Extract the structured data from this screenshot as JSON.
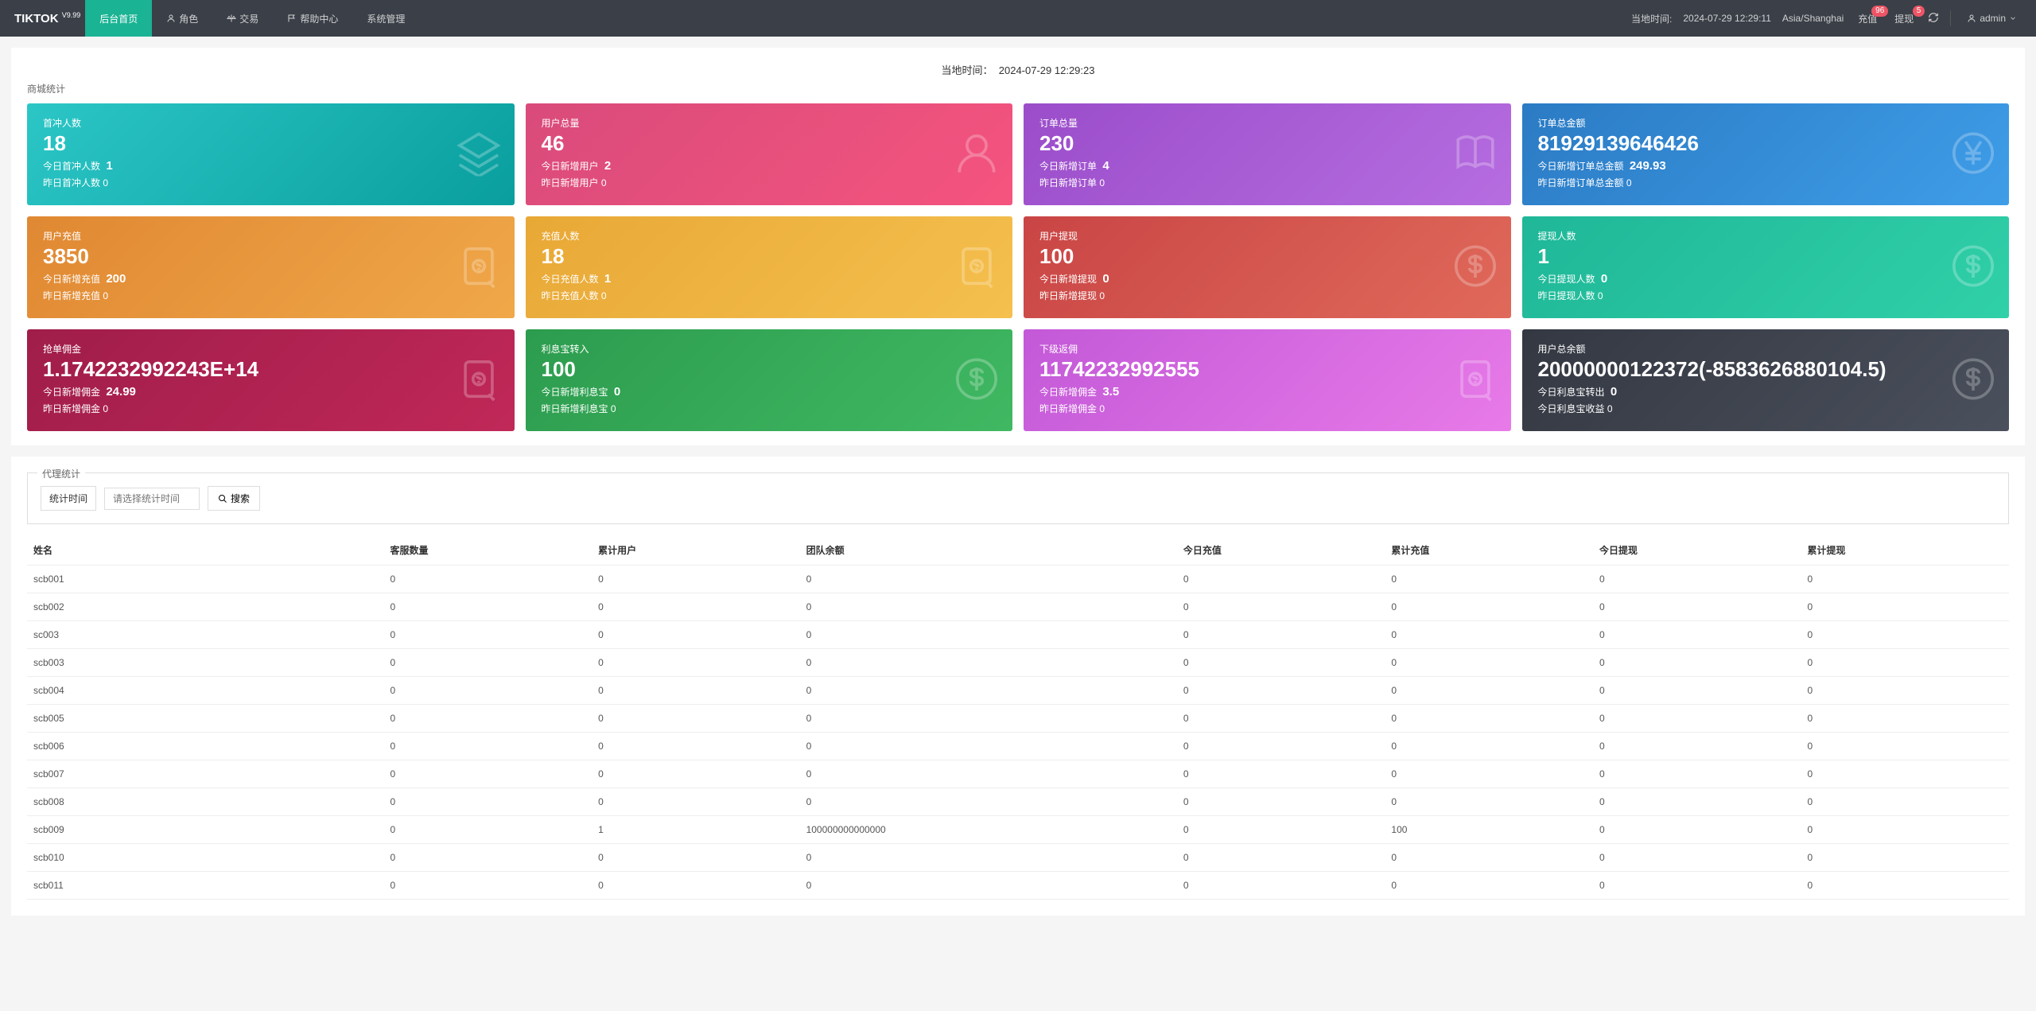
{
  "brand": {
    "name": "TIKTOK",
    "ver": "V9.99"
  },
  "nav": {
    "home": "后台首页",
    "role": "角色",
    "trade": "交易",
    "help": "帮助中心",
    "sys": "系统管理"
  },
  "navr": {
    "time_label": "当地时间:",
    "time_value": "2024-07-29 12:29:11",
    "tz": "Asia/Shanghai",
    "recharge": "充值",
    "recharge_badge": "96",
    "withdraw": "提现",
    "withdraw_badge": "5",
    "user": "admin"
  },
  "local_time": {
    "label": "当地时间：",
    "value": "2024-07-29 12:29:23"
  },
  "mall_title": "商城统计",
  "stats": [
    {
      "grad": "g-cyan",
      "t1": "首冲人数",
      "big": "18",
      "l2a": "今日首冲人数",
      "l2b": "1",
      "l3a": "昨日首冲人数",
      "l3b": "0",
      "icon": "layers"
    },
    {
      "grad": "g-pink",
      "t1": "用户总量",
      "big": "46",
      "l2a": "今日新增用户",
      "l2b": "2",
      "l3a": "昨日新增用户",
      "l3b": "0",
      "icon": "user"
    },
    {
      "grad": "g-purple",
      "t1": "订单总量",
      "big": "230",
      "l2a": "今日新增订单",
      "l2b": "4",
      "l3a": "昨日新增订单",
      "l3b": "0",
      "icon": "book"
    },
    {
      "grad": "g-blue",
      "t1": "订单总金额",
      "big": "81929139646426",
      "l2a": "今日新增订单总金额",
      "l2b": "249.93",
      "l3a": "昨日新增订单总金额",
      "l3b": "0",
      "icon": "yen"
    },
    {
      "grad": "g-orange",
      "t1": "用户充值",
      "big": "3850",
      "l2a": "今日新增充值",
      "l2b": "200",
      "l3a": "昨日新增充值",
      "l3b": "0",
      "icon": "note"
    },
    {
      "grad": "g-yellow",
      "t1": "充值人数",
      "big": "18",
      "l2a": "今日充值人数",
      "l2b": "1",
      "l3a": "昨日充值人数",
      "l3b": "0",
      "icon": "note"
    },
    {
      "grad": "g-red",
      "t1": "用户提现",
      "big": "100",
      "l2a": "今日新增提现",
      "l2b": "0",
      "l3a": "昨日新增提现",
      "l3b": "0",
      "icon": "dollar"
    },
    {
      "grad": "g-mint",
      "t1": "提现人数",
      "big": "1",
      "l2a": "今日提现人数",
      "l2b": "0",
      "l3a": "昨日提现人数",
      "l3b": "0",
      "icon": "dollar"
    },
    {
      "grad": "g-wine",
      "t1": "抢单佣金",
      "big": "1.1742232992243E+14",
      "l2a": "今日新增佣金",
      "l2b": "24.99",
      "l3a": "昨日新增佣金",
      "l3b": "0",
      "icon": "note"
    },
    {
      "grad": "g-green",
      "t1": "利息宝转入",
      "big": "100",
      "l2a": "今日新增利息宝",
      "l2b": "0",
      "l3a": "昨日新增利息宝",
      "l3b": "0",
      "icon": "dollar"
    },
    {
      "grad": "g-violet",
      "t1": "下级返佣",
      "big": "11742232992555",
      "l2a": "今日新增佣金",
      "l2b": "3.5",
      "l3a": "昨日新增佣金",
      "l3b": "0",
      "icon": "note"
    },
    {
      "grad": "g-dark",
      "t1": "用户总余额",
      "big": "20000000122372(-8583626880104.5)",
      "l2a": "今日利息宝转出",
      "l2b": "0",
      "l3a": "今日利息宝收益",
      "l3b": "0",
      "icon": "dollar"
    }
  ],
  "agent": {
    "title": "代理统计",
    "time_label": "统计时间",
    "placeholder": "请选择统计时间",
    "search": "搜索"
  },
  "table": {
    "headers": [
      "姓名",
      "客服数量",
      "累计用户",
      "团队余额",
      "今日充值",
      "累计充值",
      "今日提现",
      "累计提现"
    ],
    "rows": [
      [
        "scb001",
        "0",
        "0",
        "0",
        "0",
        "0",
        "0",
        "0"
      ],
      [
        "scb002",
        "0",
        "0",
        "0",
        "0",
        "0",
        "0",
        "0"
      ],
      [
        "sc003",
        "0",
        "0",
        "0",
        "0",
        "0",
        "0",
        "0"
      ],
      [
        "scb003",
        "0",
        "0",
        "0",
        "0",
        "0",
        "0",
        "0"
      ],
      [
        "scb004",
        "0",
        "0",
        "0",
        "0",
        "0",
        "0",
        "0"
      ],
      [
        "scb005",
        "0",
        "0",
        "0",
        "0",
        "0",
        "0",
        "0"
      ],
      [
        "scb006",
        "0",
        "0",
        "0",
        "0",
        "0",
        "0",
        "0"
      ],
      [
        "scb007",
        "0",
        "0",
        "0",
        "0",
        "0",
        "0",
        "0"
      ],
      [
        "scb008",
        "0",
        "0",
        "0",
        "0",
        "0",
        "0",
        "0"
      ],
      [
        "scb009",
        "0",
        "1",
        "100000000000000",
        "0",
        "100",
        "0",
        "0"
      ],
      [
        "scb010",
        "0",
        "0",
        "0",
        "0",
        "0",
        "0",
        "0"
      ],
      [
        "scb011",
        "0",
        "0",
        "0",
        "0",
        "0",
        "0",
        "0"
      ]
    ]
  }
}
